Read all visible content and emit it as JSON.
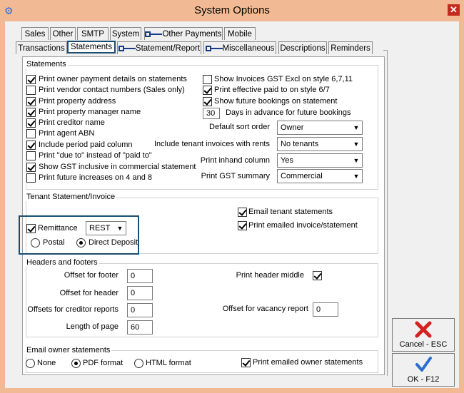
{
  "window": {
    "title": "System Options"
  },
  "tabs_row1": [
    {
      "label": "Sales"
    },
    {
      "label": "Other"
    },
    {
      "label": "SMTP"
    },
    {
      "label": "System"
    },
    {
      "label": "Other Payments"
    },
    {
      "label": "Mobile"
    }
  ],
  "tabs_row2": [
    {
      "label": "Transactions"
    },
    {
      "label": "Statements"
    },
    {
      "label": "Statement/Report"
    },
    {
      "label": "Miscellaneous"
    },
    {
      "label": "Descriptions"
    },
    {
      "label": "Reminders"
    }
  ],
  "statements": {
    "label": "Statements",
    "left_checks": [
      {
        "label": "Print owner payment details on statements",
        "checked": true
      },
      {
        "label": "Print vendor contact numbers (Sales only)",
        "checked": false
      },
      {
        "label": "Print property address",
        "checked": true
      },
      {
        "label": "Print property manager name",
        "checked": true
      },
      {
        "label": "Print creditor name",
        "checked": true
      },
      {
        "label": "Print agent ABN",
        "checked": false
      },
      {
        "label": "Include period paid column",
        "checked": true
      },
      {
        "label": "Print \"due to\" instead of \"paid to\"",
        "checked": false
      },
      {
        "label": "Show GST inclusive in commercial statement",
        "checked": true
      },
      {
        "label": "Print future increases on 4 and 8",
        "checked": false
      }
    ],
    "right_checks": [
      {
        "label": "Show Invoices GST Excl on style 6,7,11",
        "checked": false
      },
      {
        "label": "Print effective paid to on style 6/7",
        "checked": true
      },
      {
        "label": "Show future bookings on statement",
        "checked": true
      }
    ],
    "days_value": "30",
    "days_label": "Days in advance for future bookings",
    "combos": [
      {
        "label": "Default sort order",
        "value": "Owner"
      },
      {
        "label": "Include tenant invoices with rents",
        "value": "No tenants"
      },
      {
        "label": "Print inhand column",
        "value": "Yes"
      },
      {
        "label": "Print GST summary",
        "value": "Commercial"
      }
    ]
  },
  "tenant": {
    "label": "Tenant Statement/Invoice",
    "remittance_label": "Remittance",
    "remittance_checked": true,
    "remittance_value": "REST",
    "postal_label": "Postal",
    "direct_deposit_label": "Direct Deposit",
    "email_statements_label": "Email tenant statements",
    "print_emailed_label": "Print emailed invoice/statement"
  },
  "headers": {
    "label": "Headers and footers",
    "offset_footer_label": "Offset for footer",
    "offset_footer_value": "0",
    "offset_header_label": "Offset for header",
    "offset_header_value": "0",
    "creditor_label": "Offsets for creditor reports",
    "creditor_value": "0",
    "length_label": "Length of page",
    "length_value": "60",
    "print_header_middle_label": "Print header middle",
    "vacancy_label": "Offset for vacancy report",
    "vacancy_value": "0"
  },
  "email_owner": {
    "label": "Email owner statements",
    "none_label": "None",
    "pdf_label": "PDF format",
    "html_label": "HTML format",
    "print_emailed_label": "Print emailed owner statements"
  },
  "buttons": {
    "cancel": "Cancel - ESC",
    "ok": "OK - F12"
  },
  "colors": {
    "accent": "#1b4f72",
    "titlebar": "#f2ba94",
    "close": "#c42b1c",
    "cancel_icon": "#d42020",
    "ok_icon": "#2a6fd0"
  }
}
